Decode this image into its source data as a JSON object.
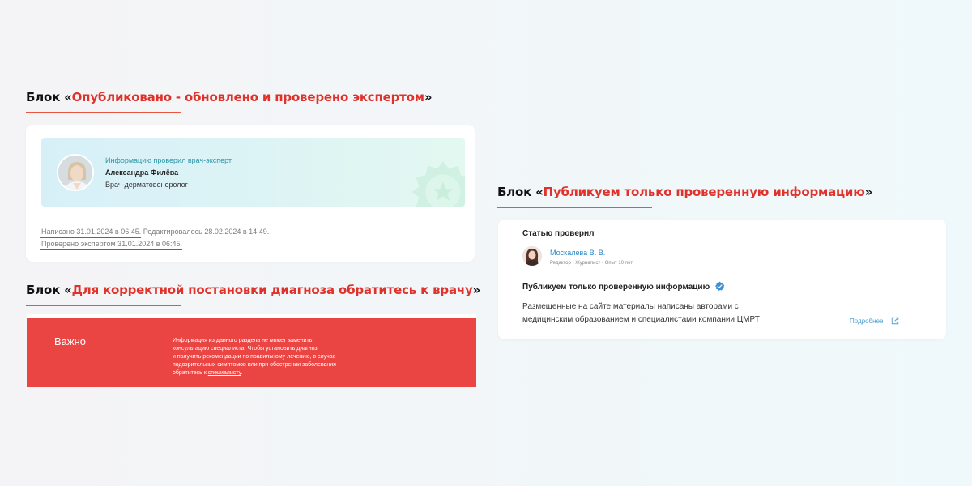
{
  "block1": {
    "title_prefix": "Блок «",
    "title_accent": "Опубликовано - обновлено и проверено экспертом",
    "title_suffix": "»",
    "expert_pretitle": "Информацию проверил врач-эксперт",
    "expert_name": "Александра Филёва",
    "expert_role": "Врач-дерматовенеролог",
    "written": "Написано 31.01.2024 в 06:45",
    "edited": ". Редактировалось 28.02.2024 в 14:49.",
    "checked": "Проверено экспертом 31.01.2024 в 06:45",
    "checked_tail": "."
  },
  "block2": {
    "title_prefix": "Блок «",
    "title_accent": "Для корректной постановки диагноза обратитесь к врачу",
    "title_suffix": "»",
    "label": "Важно",
    "text_line1": "Информация из данного раздела не может заменить",
    "text_line2": "консультацию специалиста. Чтобы установить диагноз",
    "text_line3": "и получить рекомендации по правильному лечению, в случае",
    "text_line4": "подозрительных симптомов или при обострении заболевания",
    "text_line5_pre": "обратитесь к ",
    "text_link": "специалисту",
    "text_line5_post": ".",
    "bg_color": "#eb4543"
  },
  "block3": {
    "title_prefix": "Блок «",
    "title_accent": "Публикуем только проверенную информацию",
    "title_suffix": "»",
    "checked_title": "Статью проверил",
    "author_name": "Москалева В. В.",
    "author_meta": "Редактор • Журналист • Опыт 10 лет",
    "headline": "Публикуем только проверенную информацию",
    "body_line1": "Размещенные на сайте материалы написаны авторами с",
    "body_line2": "медицинским образованием и специалистами компании ЦМРТ",
    "more_link": "Подробнее"
  },
  "colors": {
    "accent": "#e0312b",
    "link": "#2a87c7",
    "verified": "#3d8fd6"
  },
  "icons": {
    "verified": "verified-badge-icon",
    "external": "external-link-icon",
    "gear": "gear-star-icon"
  }
}
